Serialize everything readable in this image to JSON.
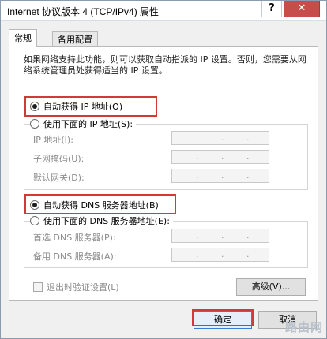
{
  "window": {
    "title": "Internet 协议版本 4 (TCP/IPv4) 属性",
    "help_label": "?",
    "close_label": "✕"
  },
  "tabs": [
    {
      "label": "常规"
    },
    {
      "label": "备用配置"
    }
  ],
  "description": "如果网络支持此功能，则可以获取自动指派的 IP 设置。否则，您需要从网络系统管理员处获得适当的 IP 设置。",
  "ip_section": {
    "auto_label": "自动获得 IP 地址(O)",
    "manual_label": "使用下面的 IP 地址(S):",
    "fields": [
      {
        "label": "IP 地址(I):"
      },
      {
        "label": "子网掩码(U):"
      },
      {
        "label": "默认网关(D):"
      }
    ]
  },
  "dns_section": {
    "auto_label": "自动获得 DNS 服务器地址(B)",
    "manual_label": "使用下面的 DNS 服务器地址(E):",
    "fields": [
      {
        "label": "首选 DNS 服务器(P):"
      },
      {
        "label": "备用 DNS 服务器(A):"
      }
    ]
  },
  "ip_placeholder_dots": ". . .",
  "validate_on_exit_label": "退出时验证设置(L)",
  "advanced_label": "高级(V)...",
  "ok_label": "确定",
  "cancel_label": "取消",
  "watermark": "路由网",
  "colors": {
    "highlight": "#d23a3a",
    "close_button": "#c74d4d"
  },
  "icons": {
    "help": "help-icon",
    "close": "close-icon"
  }
}
